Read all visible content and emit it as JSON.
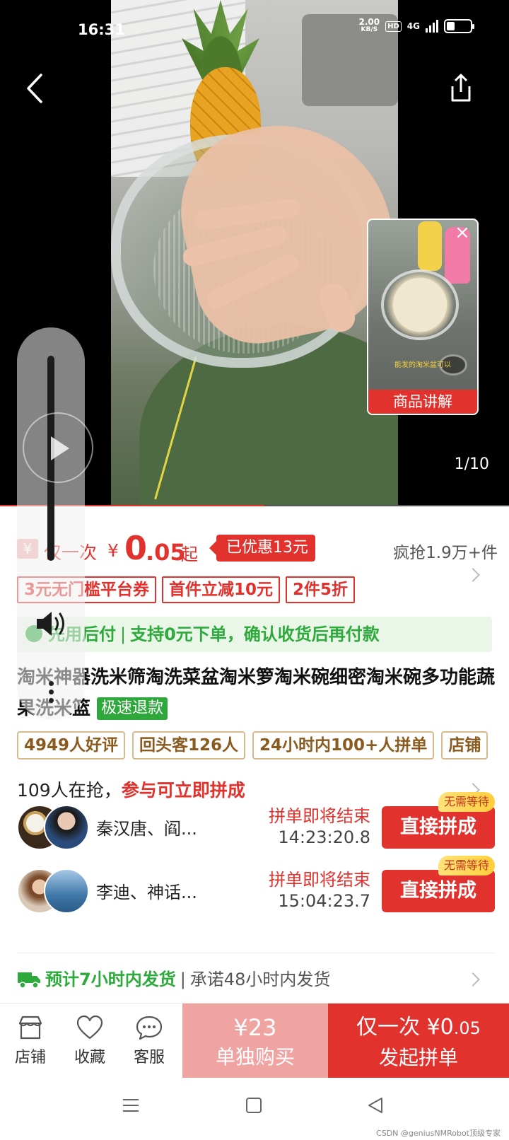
{
  "status_bar": {
    "time": "16:31",
    "net_speed": "2.00",
    "net_speed_unit": "KB/S",
    "hd_label": "HD",
    "network": "4G"
  },
  "media": {
    "pip_label": "商品讲解",
    "pip_caption": "能发的淘米盆可以",
    "page_indicator": "1/10",
    "progress": 0.52
  },
  "price": {
    "prefix": "仅一次",
    "currency": "¥",
    "integer": "0",
    "decimal": ".05",
    "suffix": "起",
    "discount_tag": "已优惠13元",
    "sold": "疯抢1.9万+件"
  },
  "coupons": [
    "3元无门槛平台券",
    "首件立减10元",
    "2件5折"
  ],
  "pay_later": {
    "title": "先用后付",
    "text": "支持0元下单，确认收货后再付款"
  },
  "product": {
    "title": "淘米神器洗米筛淘洗菜盆淘米箩淘米碗细密淘米碗多功能蔬果洗米篮",
    "refund_tag": "极速退款"
  },
  "review_tags": [
    "4949人好评",
    "回头客126人",
    "24小时内100+人拼单",
    "店铺"
  ],
  "group_buy": {
    "count_text": "109人在抢，",
    "highlight": "参与可立即拼成",
    "groups": [
      {
        "names": "秦汉唐、阎...",
        "status": "拼单即将结束",
        "timer": "14:23:20.8",
        "badge": "无需等待",
        "button": "直接拼成"
      },
      {
        "names": "李迪、神话...",
        "status": "拼单即将结束",
        "timer": "15:04:23.7",
        "badge": "无需等待",
        "button": "直接拼成"
      }
    ]
  },
  "shipping": {
    "main": "预计7小时内发货",
    "promise": "承诺48小时内发货"
  },
  "action_bar": {
    "store": "店铺",
    "favorite": "收藏",
    "service": "客服",
    "alone_price": "¥23",
    "alone_label": "单独购买",
    "group_price_prefix": "仅一次 ¥0",
    "group_price_decimal": ".05",
    "group_label": "发起拼单"
  },
  "watermark": "CSDN @geniusNMRobot顶级专家",
  "colors": {
    "accent": "#e1322d",
    "green": "#2eaa3c"
  }
}
